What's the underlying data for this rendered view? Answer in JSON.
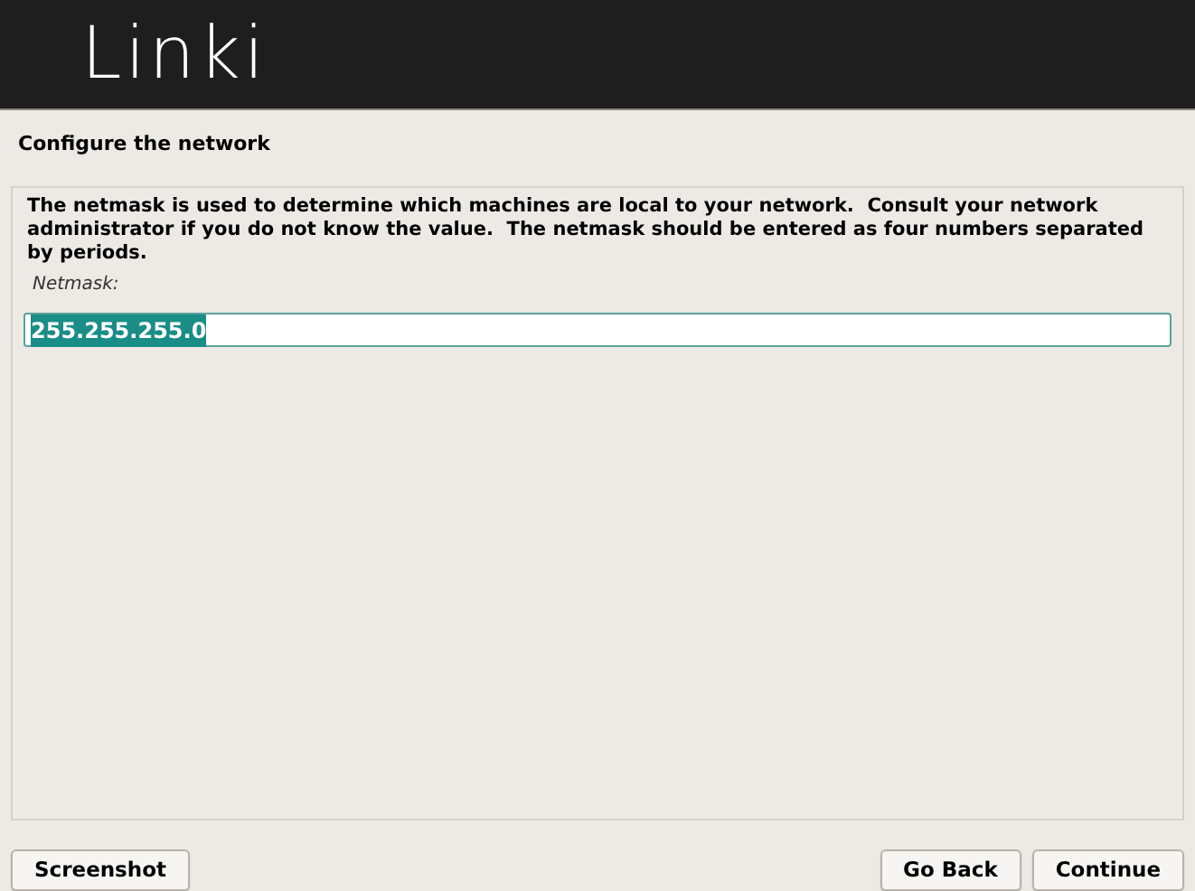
{
  "header": {
    "logo": "Linki"
  },
  "page_title": "Configure the network",
  "description": "The netmask is used to determine which machines are local to your network.  Consult your network administrator if you do not know the value.  The netmask should be entered as four numbers separated by periods.",
  "field": {
    "label": "Netmask:",
    "value": "255.255.255.0",
    "value_selected": true
  },
  "buttons": [
    {
      "label": "Screenshot",
      "kind": "left"
    },
    {
      "label": "Go Back",
      "kind": "right"
    },
    {
      "label": "Continue",
      "kind": "right"
    }
  ]
}
